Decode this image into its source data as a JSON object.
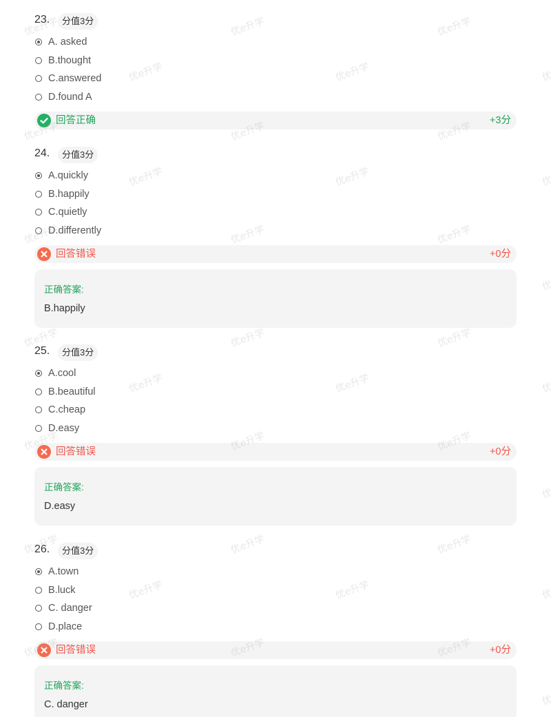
{
  "watermark_text": "优e升学",
  "colors": {
    "correct": "#22a55b",
    "wrong": "#f0564a",
    "panel": "#f4f4f4"
  },
  "questions": [
    {
      "number": "23.",
      "score_label": "分值3分",
      "options": [
        "A. asked",
        "B.thought",
        "C.answered",
        "D.found A"
      ],
      "selected_index": 0,
      "result": "correct",
      "result_icon": "check-circle-icon",
      "result_text": "回答正确",
      "result_score": "+3分"
    },
    {
      "number": "24.",
      "score_label": "分值3分",
      "options": [
        "A.quickly",
        "B.happily",
        "C.quietly",
        "D.differently"
      ],
      "selected_index": 0,
      "result": "wrong",
      "result_icon": "cross-circle-icon",
      "result_text": "回答错误",
      "result_score": "+0分",
      "correct_title": "正确答案:",
      "correct_answer": "B.happily"
    },
    {
      "number": "25.",
      "score_label": "分值3分",
      "options": [
        "A.cool",
        "B.beautiful",
        "C.cheap",
        "D.easy"
      ],
      "selected_index": 0,
      "result": "wrong",
      "result_icon": "cross-circle-icon",
      "result_text": "回答错误",
      "result_score": "+0分",
      "correct_title": "正确答案:",
      "correct_answer": "D.easy"
    },
    {
      "number": "26.",
      "score_label": "分值3分",
      "options": [
        "A.town",
        "B.luck",
        "C. danger",
        "D.place"
      ],
      "selected_index": 0,
      "result": "wrong",
      "result_icon": "cross-circle-icon",
      "result_text": "回答错误",
      "result_score": "+0分",
      "correct_title": "正确答案:",
      "correct_answer": "C. danger"
    }
  ]
}
